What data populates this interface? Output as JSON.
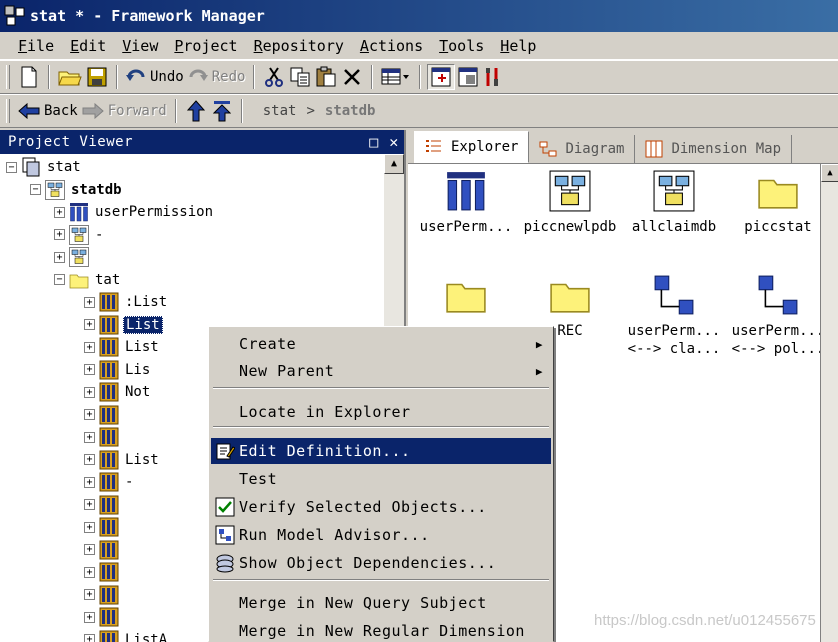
{
  "window": {
    "title": "stat * - Framework Manager"
  },
  "menu": [
    "File",
    "Edit",
    "View",
    "Project",
    "Repository",
    "Actions",
    "Tools",
    "Help"
  ],
  "toolbar": {
    "undo": "Undo",
    "redo": "Redo",
    "back": "Back",
    "forward": "Forward"
  },
  "breadcrumb": {
    "first": "stat",
    "separator": ">",
    "second": "statdb"
  },
  "project_viewer": {
    "title": "Project Viewer",
    "tree": [
      {
        "label": "stat",
        "kind": "project"
      },
      {
        "label": "statdb",
        "kind": "namespace"
      },
      {
        "label": "userPermission",
        "kind": "dimension"
      },
      {
        "label": "-",
        "kind": "namespace"
      },
      {
        "label": "",
        "kind": "namespace"
      },
      {
        "label": "tat",
        "kind": "folder"
      },
      {
        "label": ":List",
        "kind": "query"
      },
      {
        "label": "List",
        "kind": "query-selected"
      },
      {
        "label": "List",
        "kind": "query"
      },
      {
        "label": "Lis",
        "kind": "query"
      },
      {
        "label": "Not",
        "kind": "query"
      },
      {
        "label": "",
        "kind": "query"
      },
      {
        "label": "",
        "kind": "query"
      },
      {
        "label": "List",
        "kind": "query"
      },
      {
        "label": "-",
        "kind": "query"
      },
      {
        "label": "",
        "kind": "query"
      },
      {
        "label": "",
        "kind": "query"
      },
      {
        "label": "",
        "kind": "query"
      },
      {
        "label": "",
        "kind": "query"
      },
      {
        "label": "",
        "kind": "query"
      },
      {
        "label": "",
        "kind": "query"
      },
      {
        "label": "ListA",
        "kind": "query"
      },
      {
        "label": "",
        "kind": "query"
      }
    ]
  },
  "explorer": {
    "tabs": [
      "Explorer",
      "Diagram",
      "Dimension Map"
    ],
    "items": [
      {
        "label": "userPerm...",
        "kind": "dimension"
      },
      {
        "label": "piccnewlpdb",
        "kind": "namespace"
      },
      {
        "label": "allclaimdb",
        "kind": "namespace"
      },
      {
        "label": "piccstat",
        "kind": "folder"
      },
      {
        "label": "",
        "kind": "folder"
      },
      {
        "label": "REC",
        "kind": "folder"
      },
      {
        "label": "userPerm...\n<--> cla...",
        "kind": "relationship"
      },
      {
        "label": "userPerm...\n<--> pol...",
        "kind": "relationship"
      }
    ]
  },
  "context_menu": {
    "items": [
      {
        "label": "Create",
        "submenu": true
      },
      {
        "label": "New Parent",
        "submenu": true
      },
      {
        "label": "Locate in Explorer"
      },
      {
        "label": "Edit Definition..."
      },
      {
        "label": "Test"
      },
      {
        "label": "Verify Selected Objects..."
      },
      {
        "label": "Run Model Advisor..."
      },
      {
        "label": "Show Object Dependencies..."
      },
      {
        "label": "Merge in New Query Subject"
      },
      {
        "label": "Merge in New Regular Dimension"
      }
    ]
  },
  "watermark": "https://blog.csdn.net/u012455675",
  "colors": {
    "titlebar": "#0a246a",
    "selection": "#0a246a",
    "chrome": "#d4d0c8",
    "folder": "#fdf27a"
  }
}
